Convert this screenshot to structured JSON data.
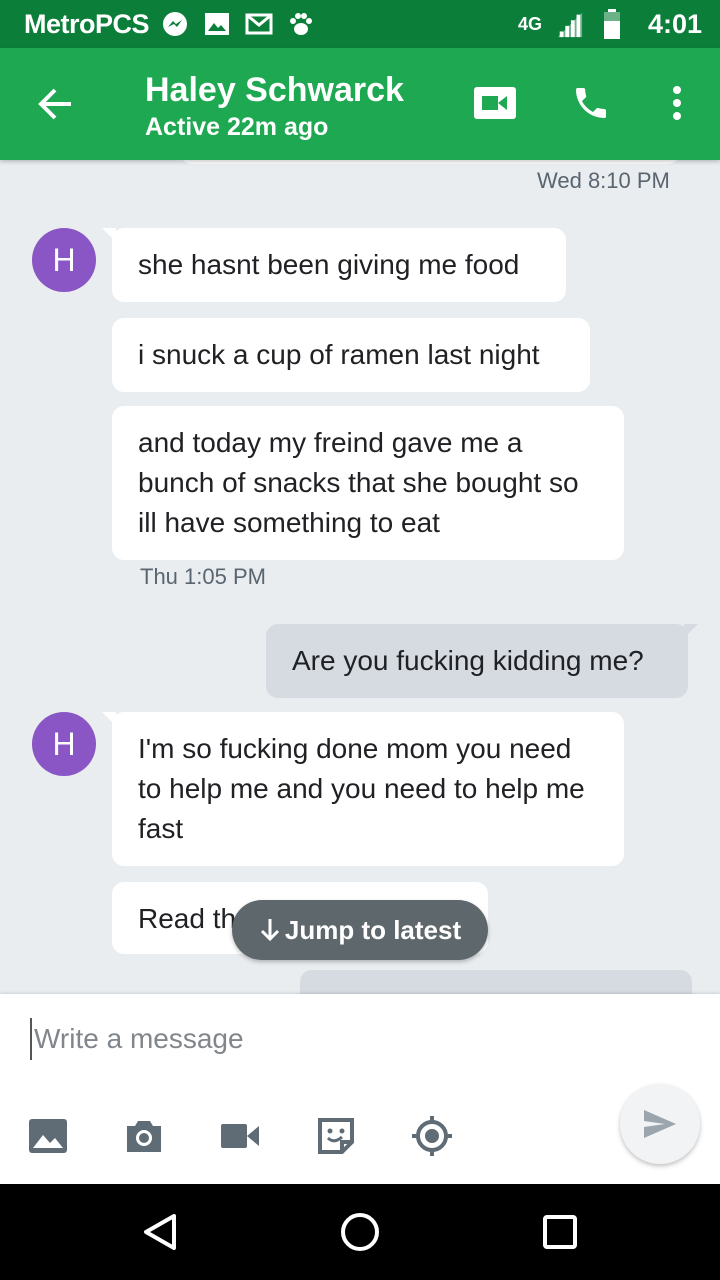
{
  "status_bar": {
    "carrier": "MetroPCS",
    "network": "4G",
    "network_sub": "LTE",
    "time": "4:01",
    "notification_icons": [
      "messenger-icon",
      "image-icon",
      "gmail-icon",
      "paw-icon"
    ]
  },
  "header": {
    "contact_name": "Haley Schwarck",
    "status": "Active 22m ago",
    "actions": [
      "back-arrow-icon",
      "video-call-icon",
      "phone-icon",
      "more-vert-icon"
    ],
    "color": "#1da851"
  },
  "conversation": {
    "timestamps": [
      "Wed 8:10 PM",
      "Thu 1:05 PM"
    ],
    "avatar_initial": "H",
    "avatar_color": "#8a55c4",
    "messages": [
      {
        "sender": "them",
        "text": "she hasnt been giving me food"
      },
      {
        "sender": "them",
        "text": "i snuck a cup of ramen last night"
      },
      {
        "sender": "them",
        "text": "and today my freind gave me a bunch of snacks that she bought so ill have something to eat"
      },
      {
        "sender": "me",
        "text": "Are you fucking kidding me?"
      },
      {
        "sender": "them",
        "text": "I'm so fucking done mom you need to help me and you need to help me fast"
      },
      {
        "sender": "them",
        "text": "Read th"
      }
    ],
    "jump_label": "Jump to latest"
  },
  "composer": {
    "placeholder": "Write a message",
    "tools": [
      "image-icon",
      "camera-icon",
      "video-icon",
      "sticker-icon",
      "location-icon"
    ],
    "send_icon": "send-icon"
  },
  "nav": [
    "back-triangle-icon",
    "home-circle-icon",
    "recents-square-icon"
  ]
}
